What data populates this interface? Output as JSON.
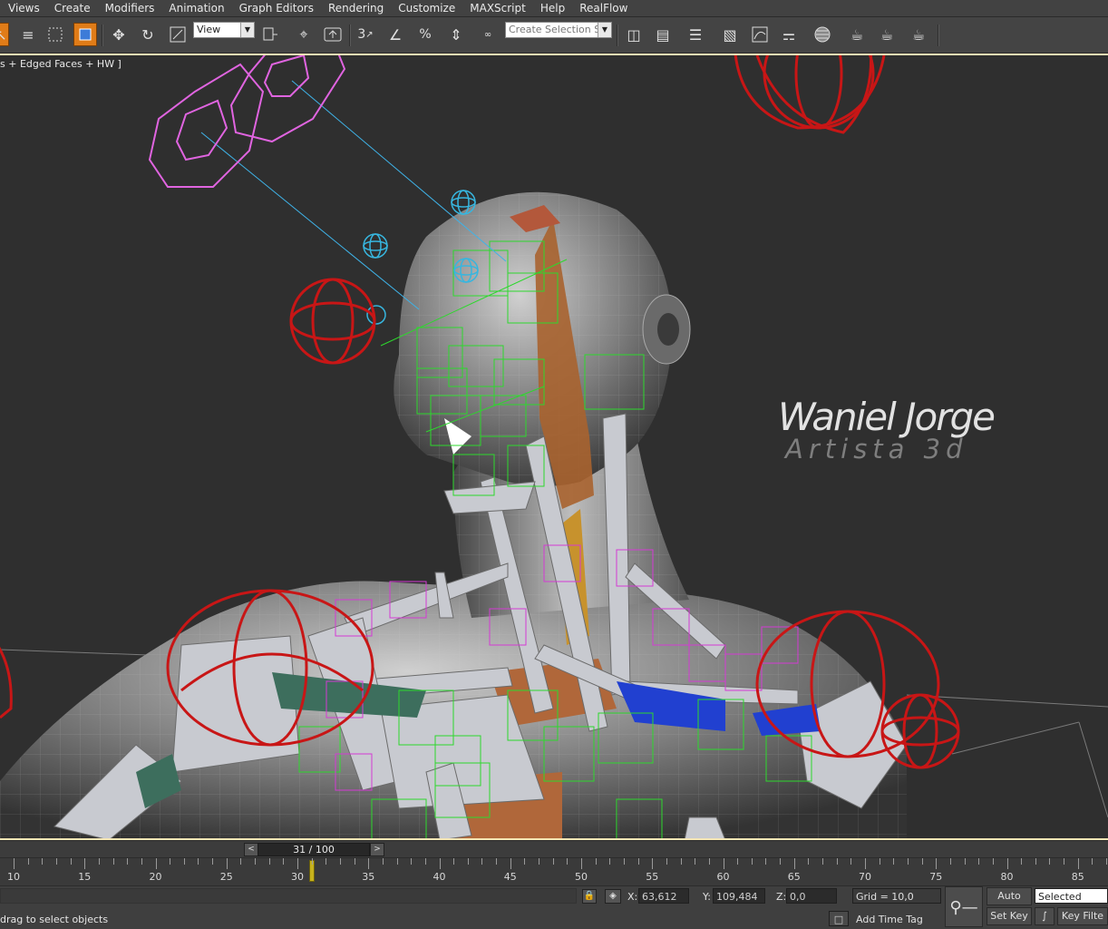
{
  "menu": [
    "Views",
    "Create",
    "Modifiers",
    "Animation",
    "Graph Editors",
    "Rendering",
    "Customize",
    "MAXScript",
    "Help",
    "RealFlow"
  ],
  "toolbar": {
    "reference_coord": "View",
    "selection_set_placeholder": "Create Selection Se",
    "snap_numbers": [
      "3",
      "%"
    ]
  },
  "viewport": {
    "label": "s + Edged Faces + HW ]",
    "watermark_name": "Waniel Jorge",
    "watermark_role": "Artista 3d"
  },
  "timeslider": {
    "frame": "31 / 100",
    "prev": "<",
    "next": ">"
  },
  "trackbar": {
    "ticks": [
      "10",
      "15",
      "20",
      "25",
      "30",
      "35",
      "40",
      "45",
      "50",
      "55",
      "60",
      "65",
      "70",
      "75",
      "80",
      "85"
    ]
  },
  "status": {
    "x_label": "X:",
    "x_value": "63,612",
    "y_label": "Y:",
    "y_value": "109,484",
    "z_label": "Z:",
    "z_value": "0,0",
    "grid": "Grid = 10,0",
    "prompt": "drag to select objects",
    "add_time_tag": "Add Time Tag",
    "auto_key": "Auto Key",
    "set_key": "Set Key",
    "key_mode": "Selected",
    "key_filters": "Key Filte"
  },
  "colors": {
    "viewport_border": "#f5e6b5",
    "active_tool": "#e07c18",
    "playhead": "#c6b21c"
  }
}
